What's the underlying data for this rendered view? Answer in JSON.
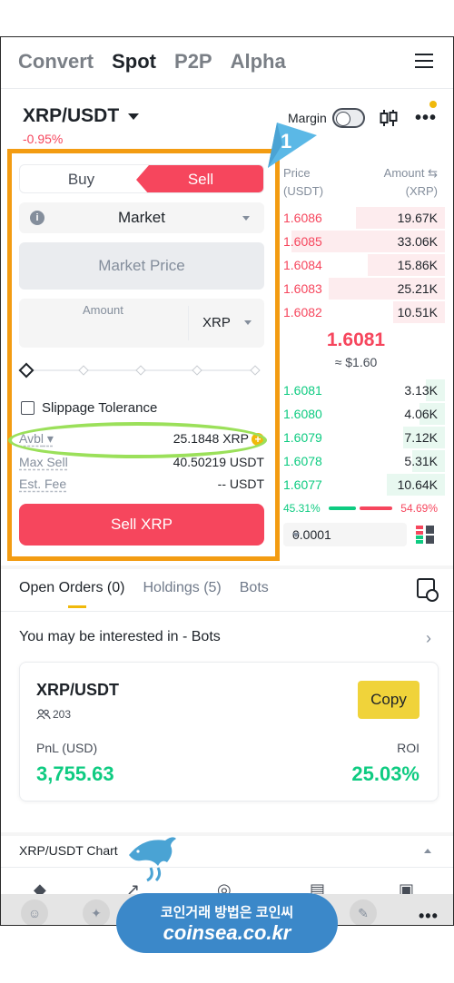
{
  "nav": {
    "tabs": [
      {
        "label": "Convert",
        "active": false
      },
      {
        "label": "Spot",
        "active": true
      },
      {
        "label": "P2P",
        "active": false
      },
      {
        "label": "Alpha",
        "active": false
      }
    ]
  },
  "pair": {
    "symbol": "XRP/USDT",
    "change": "-0.95%",
    "margin_label": "Margin"
  },
  "annotation": {
    "number": "1",
    "box_color": "#f39c12",
    "oval_color": "#9be05a"
  },
  "order_form": {
    "buy_label": "Buy",
    "sell_label": "Sell",
    "order_type": "Market",
    "price_placeholder": "Market Price",
    "amount_label": "Amount",
    "amount_unit": "XRP",
    "slippage_label": "Slippage Tolerance",
    "avbl_label": "Avbl",
    "avbl_value": "25.1848 XRP",
    "max_sell_label": "Max Sell",
    "max_sell_value": "40.50219 USDT",
    "fee_label": "Est. Fee",
    "fee_value": "-- USDT",
    "submit_label": "Sell XRP"
  },
  "order_book": {
    "price_header": "Price",
    "price_unit": "(USDT)",
    "amount_header": "Amount",
    "amount_unit": "(XRP)",
    "asks": [
      {
        "price": "1.6086",
        "amount": "19.67K",
        "depth": 0.55
      },
      {
        "price": "1.6085",
        "amount": "33.06K",
        "depth": 0.95
      },
      {
        "price": "1.6084",
        "amount": "15.86K",
        "depth": 0.48
      },
      {
        "price": "1.6083",
        "amount": "25.21K",
        "depth": 0.72
      },
      {
        "price": "1.6082",
        "amount": "10.51K",
        "depth": 0.32
      }
    ],
    "last_price": "1.6081",
    "last_price_usd": "≈ $1.60",
    "bids": [
      {
        "price": "1.6081",
        "amount": "3.13K",
        "depth": 0.12
      },
      {
        "price": "1.6080",
        "amount": "4.06K",
        "depth": 0.16
      },
      {
        "price": "1.6079",
        "amount": "7.12K",
        "depth": 0.26
      },
      {
        "price": "1.6078",
        "amount": "5.31K",
        "depth": 0.2
      },
      {
        "price": "1.6077",
        "amount": "10.64K",
        "depth": 0.36
      }
    ],
    "buy_ratio": "45.31%",
    "sell_ratio": "54.69%",
    "precision": "0.0001"
  },
  "tabs": [
    {
      "label": "Open Orders (0)",
      "active": true
    },
    {
      "label": "Holdings (5)",
      "active": false
    },
    {
      "label": "Bots",
      "active": false
    }
  ],
  "interest": {
    "title": "You may be interested in - Bots"
  },
  "bot": {
    "pair": "XRP/USDT",
    "users": "203",
    "copy_label": "Copy",
    "pnl_label": "PnL (USD)",
    "pnl_value": "3,755.63",
    "roi_label": "ROI",
    "roi_value": "25.03%"
  },
  "chart_section": {
    "title": "XRP/USDT Chart"
  },
  "watermark": {
    "line1": "코인거래 방법은 코인씨",
    "line2": "coinsea.co.kr"
  },
  "colors": {
    "sell": "#f6465d",
    "buy": "#0ecb81",
    "accent": "#f0b90b"
  }
}
